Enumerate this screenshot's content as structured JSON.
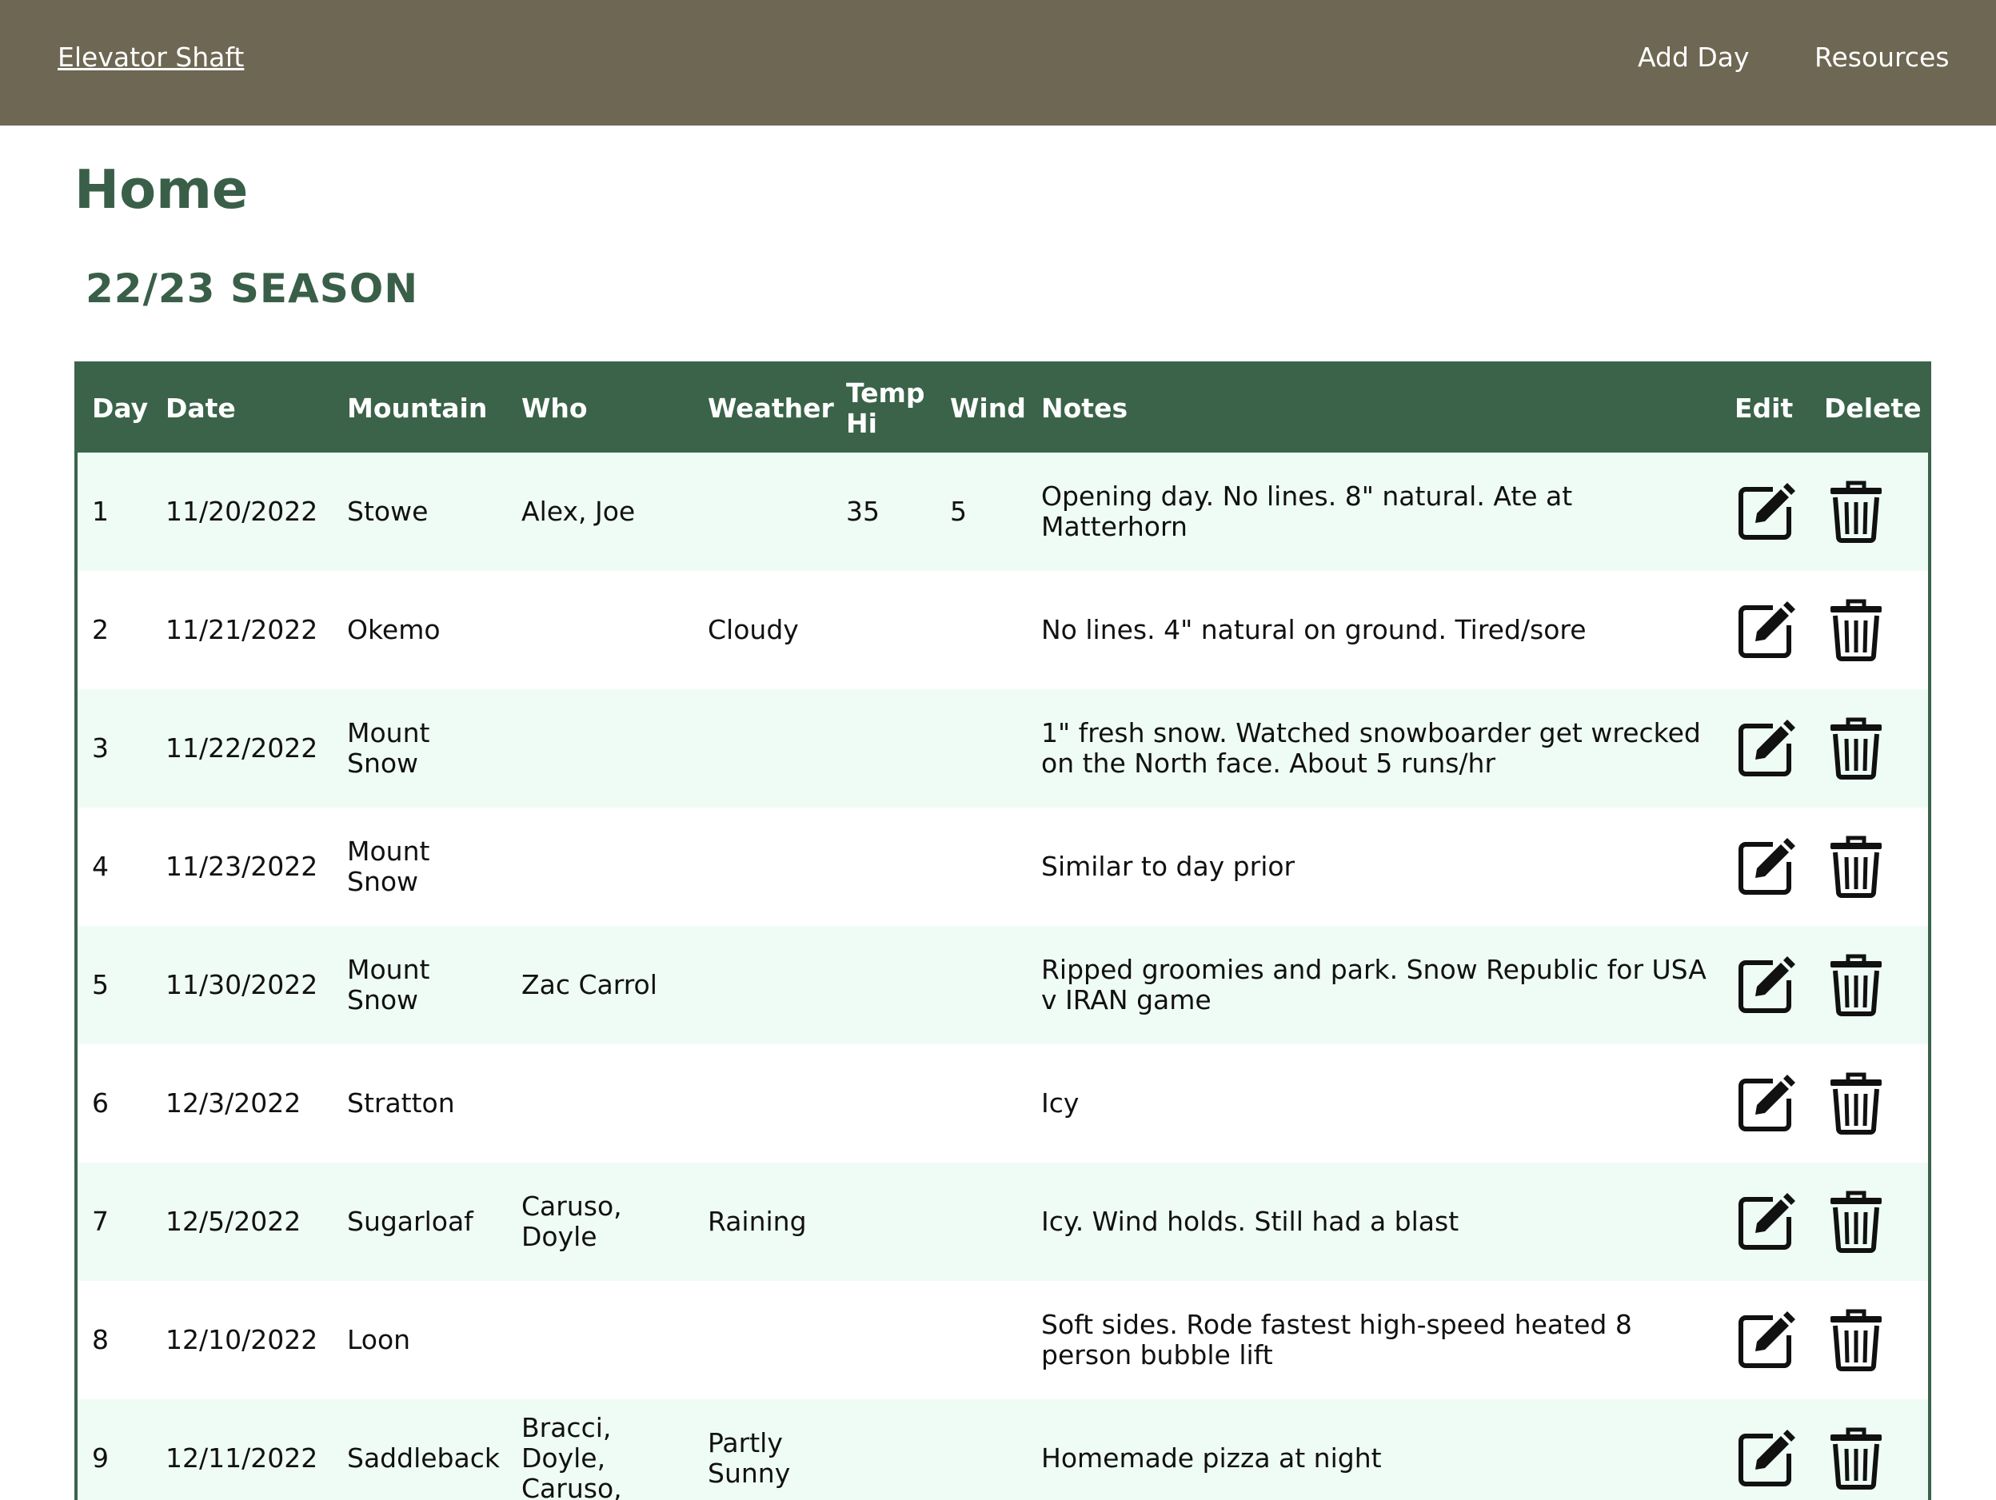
{
  "nav": {
    "brand": "Elevator Shaft",
    "links": [
      "Add Day",
      "Resources"
    ]
  },
  "page": {
    "title": "Home",
    "season": "22/23 SEASON"
  },
  "table": {
    "headers": [
      "Day",
      "Date",
      "Mountain",
      "Who",
      "Weather",
      "Temp Hi",
      "Wind",
      "Notes",
      "Edit",
      "Delete"
    ],
    "rows": [
      [
        "1",
        "11/20/2022",
        "Stowe",
        "Alex, Joe",
        "",
        "35",
        "5",
        "Opening day. No lines. 8\" natural. Ate at Matterhorn"
      ],
      [
        "2",
        "11/21/2022",
        "Okemo",
        "",
        "Cloudy",
        "",
        "",
        "No lines. 4\" natural on ground. Tired/sore"
      ],
      [
        "3",
        "11/22/2022",
        "Mount Snow",
        "",
        "",
        "",
        "",
        "1\" fresh snow. Watched snowboarder get wrecked on the North face. About 5 runs/hr"
      ],
      [
        "4",
        "11/23/2022",
        "Mount Snow",
        "",
        "",
        "",
        "",
        "Similar to day prior"
      ],
      [
        "5",
        "11/30/2022",
        "Mount Snow",
        "Zac Carrol",
        "",
        "",
        "",
        "Ripped groomies and park. Snow Republic for USA v IRAN game"
      ],
      [
        "6",
        "12/3/2022",
        "Stratton",
        "",
        "",
        "",
        "",
        "Icy"
      ],
      [
        "7",
        "12/5/2022",
        "Sugarloaf",
        "Caruso, Doyle",
        "Raining",
        "",
        "",
        "Icy. Wind holds. Still had a blast"
      ],
      [
        "8",
        "12/10/2022",
        "Loon",
        "",
        "",
        "",
        "",
        "Soft sides. Rode fastest high-speed heated 8 person bubble lift"
      ],
      [
        "9",
        "12/11/2022",
        "Saddleback",
        "Bracci, Doyle, Caruso,",
        "Partly Sunny",
        "",
        "",
        "Homemade pizza at night"
      ]
    ],
    "edit_icon": "edit-icon",
    "delete_icon": "trash-icon"
  }
}
